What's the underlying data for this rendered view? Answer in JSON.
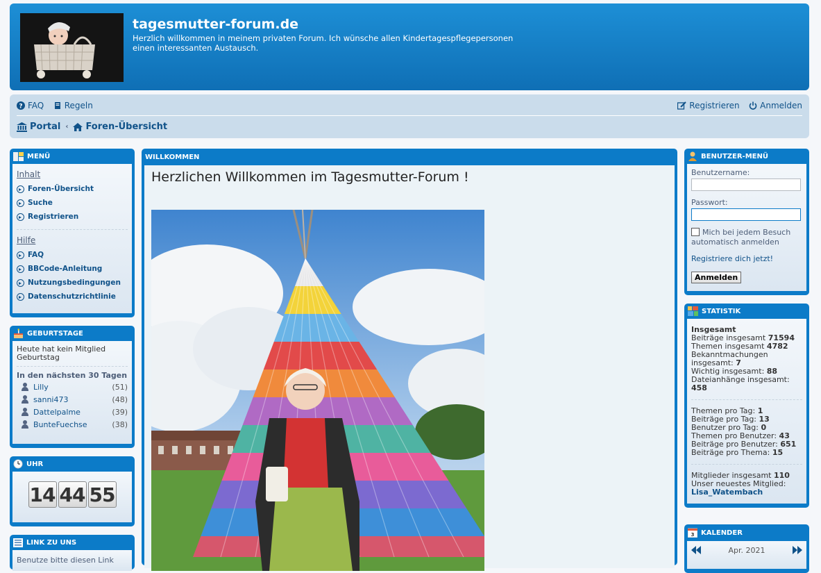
{
  "header": {
    "site_title": "tagesmutter-forum.de",
    "site_description": "Herzlich willkommen in meinem privaten Forum. Ich wünsche allen Kindertagespflegepersonen einen interessanten Austausch."
  },
  "navbar": {
    "faq": "FAQ",
    "rules": "Regeln",
    "register": "Registrieren",
    "login": "Anmelden",
    "breadcrumb_portal": "Portal",
    "breadcrumb_forums": "Foren-Übersicht"
  },
  "menu_panel": {
    "title": "MENÜ",
    "section1": "Inhalt",
    "items1": [
      "Foren-Übersicht",
      "Suche",
      "Registrieren"
    ],
    "section2": "Hilfe",
    "items2": [
      "FAQ",
      "BBCode-Anleitung",
      "Nutzungsbedingungen",
      "Datenschutzrichtlinie"
    ]
  },
  "birthday_panel": {
    "title": "GEBURTSTAGE",
    "today_text": "Heute hat kein Mitglied Geburtstag",
    "upcoming_head": "In den nächsten 30 Tagen",
    "people": [
      {
        "name": "Lilly",
        "age": "(51)"
      },
      {
        "name": "sanni473",
        "age": "(48)"
      },
      {
        "name": "Dattelpalme",
        "age": "(39)"
      },
      {
        "name": "BunteFuechse",
        "age": "(38)"
      }
    ]
  },
  "clock_panel": {
    "title": "UHR",
    "hours": "14",
    "minutes": "44",
    "seconds": "55"
  },
  "link_panel": {
    "title": "LINK ZU UNS",
    "text": "Benutze bitte diesen Link"
  },
  "welcome": {
    "panel_title": "WILLKOMMEN",
    "heading": "Herzlichen Willkommen im Tagesmutter-Forum !"
  },
  "user_menu": {
    "title": "BENUTZER-MENÜ",
    "username_label": "Benutzername:",
    "password_label": "Passwort:",
    "remember_label": "Mich bei jedem Besuch automatisch anmelden",
    "register_link": "Registriere dich jetzt!",
    "login_button": "Anmelden"
  },
  "stats": {
    "title": "STATISTIK",
    "total_head": "Insgesamt",
    "group1": [
      {
        "label": "Beiträge insgesamt",
        "value": "71594"
      },
      {
        "label": "Themen insgesamt",
        "value": "4782"
      },
      {
        "label": "Bekanntmachungen insgesamt:",
        "value": "7"
      },
      {
        "label": "Wichtig insgesamt:",
        "value": "88"
      },
      {
        "label": "Dateianhänge insgesamt:",
        "value": "458"
      }
    ],
    "group2": [
      {
        "label": "Themen pro Tag:",
        "value": "1"
      },
      {
        "label": "Beiträge pro Tag:",
        "value": "13"
      },
      {
        "label": "Benutzer pro Tag:",
        "value": "0"
      },
      {
        "label": "Themen pro Benutzer:",
        "value": "43"
      },
      {
        "label": "Beiträge pro Benutzer:",
        "value": "651"
      },
      {
        "label": "Beiträge pro Thema:",
        "value": "15"
      }
    ],
    "members_label": "Mitglieder insgesamt",
    "members_value": "110",
    "newest_label": "Unser neuestes Mitglied:",
    "newest_value": "Lisa_Watembach"
  },
  "calendar": {
    "title": "KALENDER",
    "month": "Apr. 2021"
  }
}
